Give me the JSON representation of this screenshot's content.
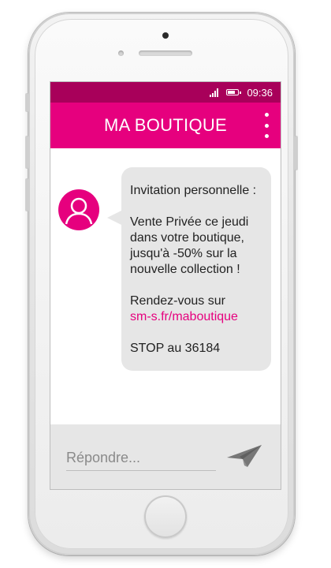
{
  "status_bar": {
    "time": "09:36",
    "signal_icon": "signal-icon",
    "battery_icon": "battery-icon"
  },
  "app_bar": {
    "title": "MA BOUTIQUE",
    "menu_icon": "more-vert-icon"
  },
  "message": {
    "avatar_icon": "user-avatar-icon",
    "line1": "Invitation personnelle :",
    "line2": "Vente Privée ce jeudi",
    "line3": "dans votre boutique,",
    "line4": "jusqu'à -50% sur la",
    "line5": "nouvelle collection !",
    "line6": "Rendez-vous sur",
    "link": "sm-s.fr/maboutique",
    "line7": "STOP au 36184"
  },
  "reply": {
    "placeholder": "Répondre...",
    "send_icon": "send-paper-plane-icon"
  },
  "colors": {
    "status_bar": "#a8005a",
    "app_bar": "#e6007e",
    "bubble": "#e6e6e6",
    "link": "#e6007e",
    "reply_bar": "#e6e6e6"
  }
}
